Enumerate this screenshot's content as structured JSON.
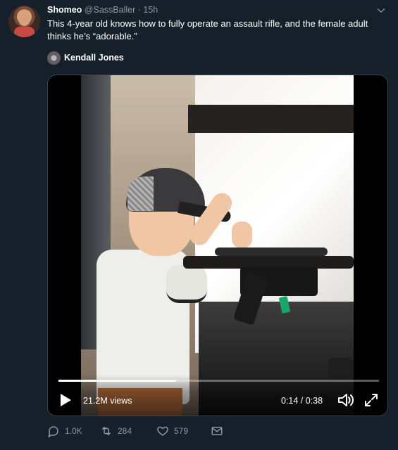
{
  "tweet": {
    "author_name": "Shomeo",
    "author_handle": "@SassBaller",
    "dot": "·",
    "time": "15h",
    "text": "This 4-year old knows how to fully operate an assault rifle, and the female adult thinks he’s “adorable.”"
  },
  "media": {
    "source_name": "Kendall Jones",
    "views": "21.2M views",
    "timestamp": "0:14 / 0:38",
    "progress_fraction": 0.366
  },
  "actions": {
    "reply_count": "1.0K",
    "retweet_count": "284",
    "like_count": "579"
  },
  "icons": {
    "caret": "chevron-down-icon",
    "play": "play-icon",
    "volume": "volume-icon",
    "fullscreen": "fullscreen-icon",
    "reply": "reply-icon",
    "retweet": "retweet-icon",
    "like": "heart-icon",
    "dm": "mail-icon"
  },
  "colors": {
    "background": "#15202b",
    "muted_text": "#8899a6",
    "border": "#38444d"
  }
}
